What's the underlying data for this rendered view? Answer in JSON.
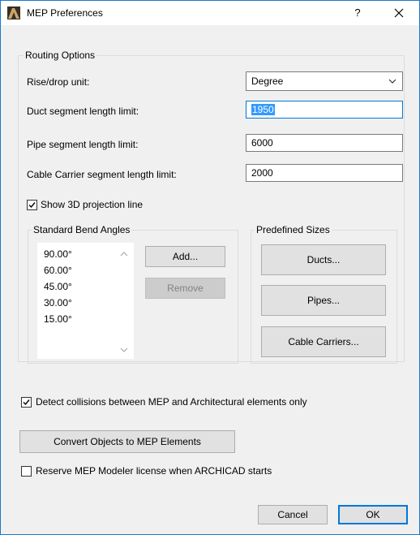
{
  "window": {
    "title": "MEP Preferences",
    "help": "?",
    "close": "✕"
  },
  "routing": {
    "title": "Routing Options",
    "rise_drop_label": "Rise/drop unit:",
    "rise_drop_value": "Degree",
    "duct_label": "Duct segment length limit:",
    "duct_value": "1950",
    "pipe_label": "Pipe segment length limit:",
    "pipe_value": "6000",
    "cable_label": "Cable Carrier segment length limit:",
    "cable_value": "2000",
    "show_3d_label": "Show 3D projection line",
    "show_3d_checked": true
  },
  "bend_angles": {
    "title": "Standard Bend Angles",
    "items": [
      "90.00°",
      "60.00°",
      "45.00°",
      "30.00°",
      "15.00°"
    ],
    "add_label": "Add...",
    "remove_label": "Remove"
  },
  "sizes": {
    "title": "Predefined Sizes",
    "ducts_label": "Ducts...",
    "pipes_label": "Pipes...",
    "cable_label": "Cable Carriers..."
  },
  "detect_label": "Detect collisions between MEP and Architectural elements only",
  "detect_checked": true,
  "convert_label": "Convert Objects to MEP Elements",
  "reserve_label": "Reserve MEP Modeler license when ARCHICAD starts",
  "reserve_checked": false,
  "footer": {
    "cancel_label": "Cancel",
    "ok_label": "OK"
  },
  "colors": {
    "accent": "#0078d7",
    "selection": "#3399ff",
    "border": "#1979ca"
  }
}
